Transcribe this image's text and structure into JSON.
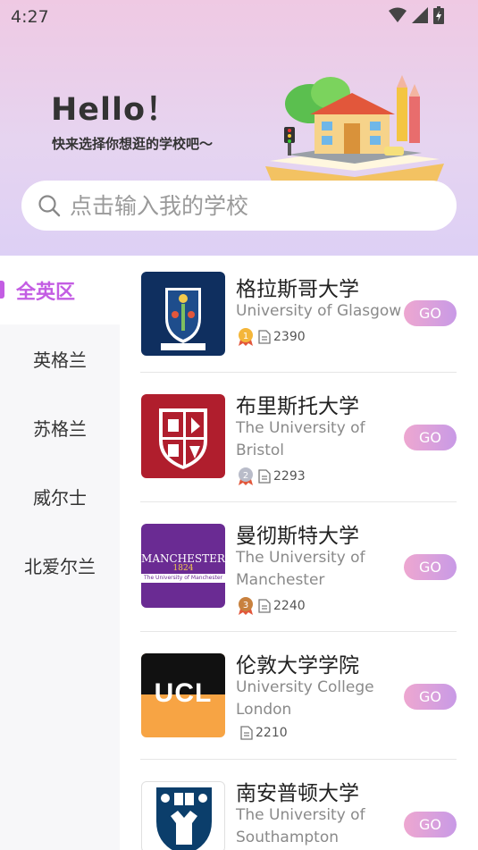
{
  "status": {
    "time": "4:27"
  },
  "header": {
    "greeting": "Hello！",
    "subtitle": "快来选择你想逛的学校吧～"
  },
  "search": {
    "placeholder": "点击输入我的学校"
  },
  "sidebar": {
    "items": [
      {
        "label": "全英区",
        "active": true
      },
      {
        "label": "英格兰",
        "active": false
      },
      {
        "label": "苏格兰",
        "active": false
      },
      {
        "label": "威尔士",
        "active": false
      },
      {
        "label": "北爱尔兰",
        "active": false
      }
    ]
  },
  "universities": [
    {
      "name_cn": "格拉斯哥大学",
      "name_en": "University of Glasgow",
      "rank": "1",
      "count": "2390",
      "go": "GO",
      "logo_color": "#0f2f5f"
    },
    {
      "name_cn": "布里斯托大学",
      "name_en": "The University of Bristol",
      "rank": "2",
      "count": "2293",
      "go": "GO",
      "logo_color": "#b01e2d"
    },
    {
      "name_cn": "曼彻斯特大学",
      "name_en": "The University of Manchester",
      "rank": "3",
      "count": "2240",
      "go": "GO",
      "logo_color": "#6a2b93",
      "logo_text": "MANCHESTER",
      "logo_year": "1824",
      "logo_sub": "The University of Manchester"
    },
    {
      "name_cn": "伦敦大学学院",
      "name_en": "University College London",
      "rank": "",
      "count": "2210",
      "go": "GO",
      "logo_color": "#f7a444",
      "logo_text": "UCL"
    },
    {
      "name_cn": "南安普顿大学",
      "name_en": "The University of Southampton",
      "rank": "",
      "count": "",
      "go": "GO",
      "logo_color": "#0b3e6b"
    }
  ],
  "colors": {
    "accent": "#c35de3",
    "go_start": "#eea7d0",
    "go_end": "#c89ae6"
  }
}
